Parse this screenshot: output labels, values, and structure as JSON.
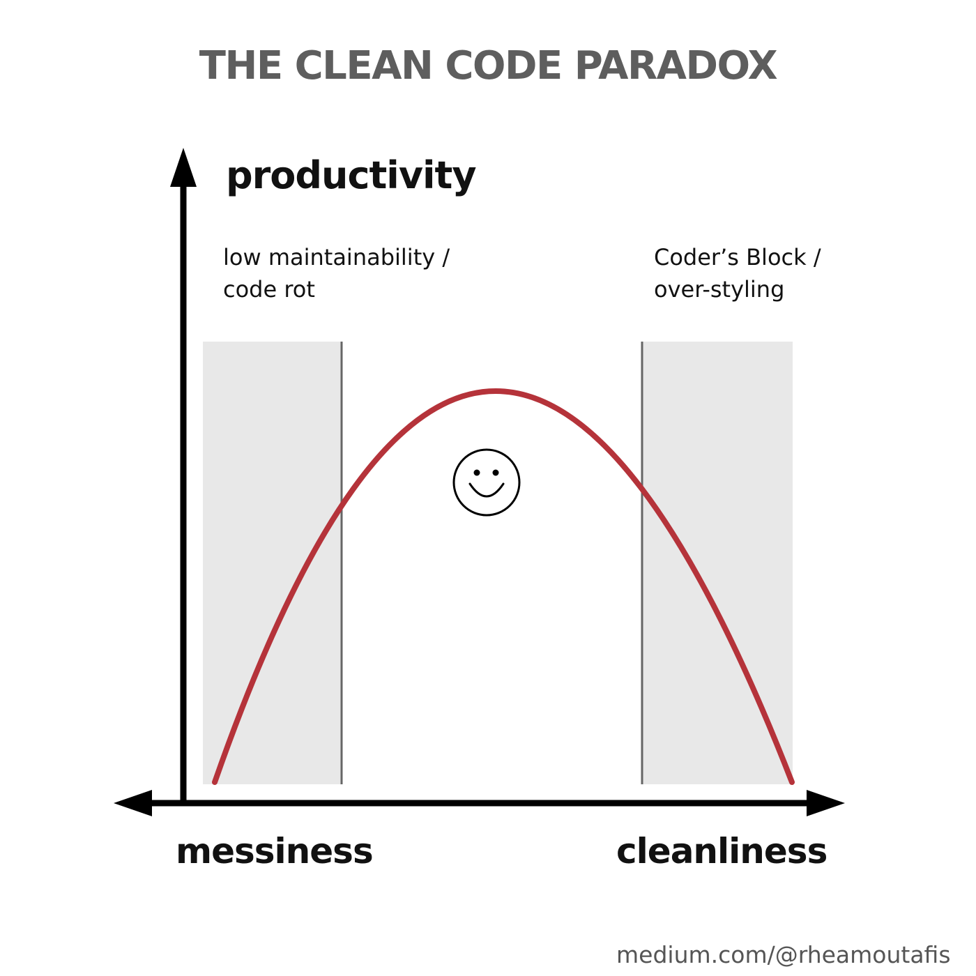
{
  "title": "THE CLEAN CODE PARADOX",
  "axes": {
    "y_label": "productivity",
    "x_left_label": "messiness",
    "x_right_label": "cleanliness"
  },
  "zones": {
    "left": {
      "line1": "low maintainability /",
      "line2": "code rot"
    },
    "right": {
      "line1": "Coder’s Block /",
      "line2": "over-styling"
    }
  },
  "icons": {
    "center": "smiley-face-icon"
  },
  "colors": {
    "curve": "#b5333a",
    "zone_fill": "#e8e8e8",
    "zone_border": "#666666",
    "axis": "#000000",
    "title": "#5e5e5e"
  },
  "credit": "medium.com/@rheamoutafis"
}
